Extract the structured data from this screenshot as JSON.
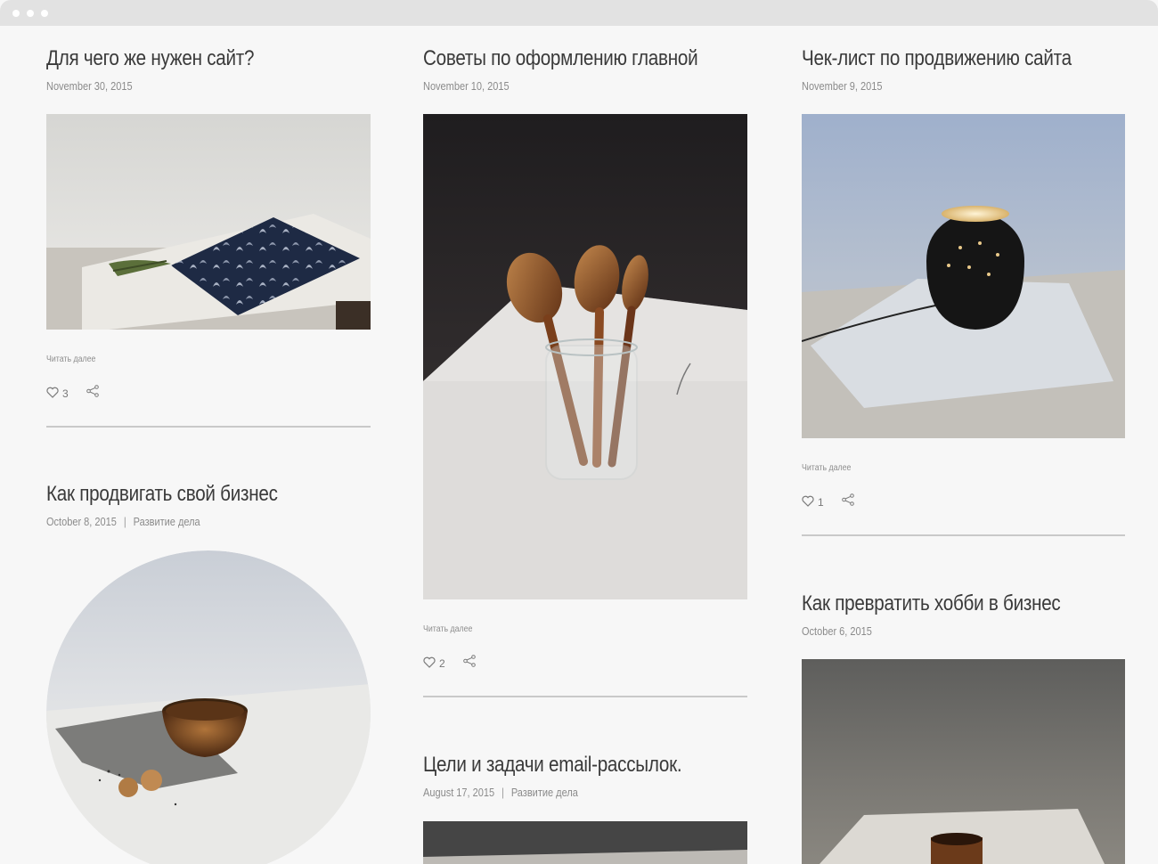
{
  "window": {
    "controls": [
      "close",
      "minimize",
      "maximize"
    ]
  },
  "read_more_label": "Читать далее",
  "colors": {
    "page_bg": "#f7f7f7",
    "titlebar_bg": "#e2e2e2",
    "title_text": "#3a3a3a",
    "meta_text": "#8b8b8b",
    "divider": "#c9c9c9"
  },
  "posts": [
    {
      "title": "Для чего же нужен сайт?",
      "date": "November 30, 2015",
      "category": "",
      "likes": "3",
      "image": "linen-tablecloth-with-patterned-placemat-and-pine-branch"
    },
    {
      "title": "Советы по оформлению главной",
      "date": "November 10, 2015",
      "category": "",
      "likes": "2",
      "image": "wooden-spoons-in-glass-jar"
    },
    {
      "title": "Чек-лист по продвижению сайта",
      "date": "November 9, 2015",
      "category": "",
      "likes": "1",
      "image": "black-perforated-lamp-on-linen"
    },
    {
      "title": "Как продвигать свой бизнес",
      "date": "October 8, 2015",
      "category": "Развитие дела",
      "image": "wooden-bowl-with-walnuts"
    },
    {
      "title": "Цели и задачи email-рассылок.",
      "date": "August 17, 2015",
      "category": "Развитие дела",
      "image": "dark-table-scene"
    },
    {
      "title": "Как превратить хобби в бизнес",
      "date": "October 6, 2015",
      "category": "",
      "image": "wooden-cup-on-table"
    }
  ]
}
